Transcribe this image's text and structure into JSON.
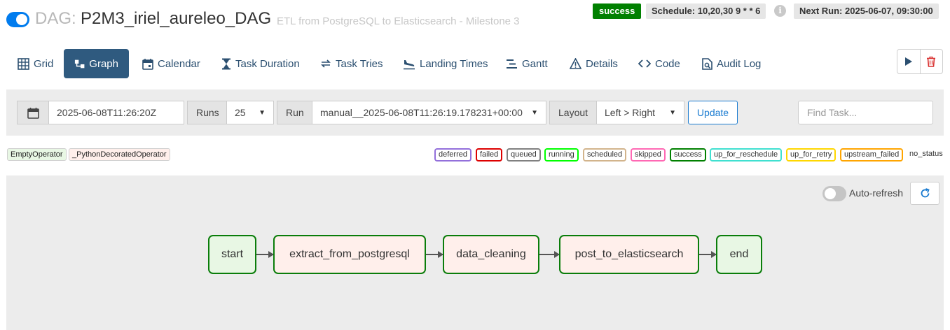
{
  "header": {
    "dag_prefix": "DAG:",
    "dag_id": "P2M3_iriel_aureleo_DAG",
    "description": "ETL from PostgreSQL to Elasticsearch - Milestone 3",
    "state": "success",
    "schedule": "Schedule: 10,20,30 9 * * 6",
    "info_icon_glyph": "i",
    "next_run": "Next Run: 2025-06-07, 09:30:00",
    "colors": {
      "toggle_on": "#017cee",
      "success": "#008000"
    }
  },
  "nav": {
    "tabs": [
      {
        "label": "Grid",
        "icon": "grid-icon"
      },
      {
        "label": "Graph",
        "icon": "graph-icon",
        "active": true
      },
      {
        "label": "Calendar",
        "icon": "calendar-icon"
      },
      {
        "label": "Task Duration",
        "icon": "hourglass-icon"
      },
      {
        "label": "Task Tries",
        "icon": "retry-arrows-icon"
      },
      {
        "label": "Landing Times",
        "icon": "plane-landing-icon"
      },
      {
        "label": "Gantt",
        "icon": "gantt-icon"
      },
      {
        "label": "Details",
        "icon": "warning-triangle-icon"
      },
      {
        "label": "Code",
        "icon": "code-icon"
      },
      {
        "label": "Audit Log",
        "icon": "file-search-icon"
      }
    ],
    "actions": [
      {
        "name": "trigger-dag",
        "icon": "play-icon"
      },
      {
        "name": "delete-dag",
        "icon": "trash-icon"
      }
    ]
  },
  "controls": {
    "base_date": "2025-06-08T11:26:20Z",
    "runs_label": "Runs",
    "runs_value": "25",
    "run_label": "Run",
    "run_value": "manual__2025-06-08T11:26:19.178231+00:00",
    "layout_label": "Layout",
    "layout_value": "Left > Right",
    "update_label": "Update",
    "find_task_placeholder": "Find Task..."
  },
  "operator_legend": [
    {
      "label": "EmptyOperator",
      "color": "#e8f7e4"
    },
    {
      "label": "_PythonDecoratedOperator",
      "color": "#ffefeb"
    }
  ],
  "state_legend": [
    {
      "label": "deferred",
      "color": "#9370db"
    },
    {
      "label": "failed",
      "color": "#dd0000"
    },
    {
      "label": "queued",
      "color": "#808080"
    },
    {
      "label": "running",
      "color": "#00ff00"
    },
    {
      "label": "scheduled",
      "color": "#d2b48c"
    },
    {
      "label": "skipped",
      "color": "#ff69b4"
    },
    {
      "label": "success",
      "color": "#008000"
    },
    {
      "label": "up_for_reschedule",
      "color": "#40e0d0"
    },
    {
      "label": "up_for_retry",
      "color": "#ffd700"
    },
    {
      "label": "upstream_failed",
      "color": "#ffa500"
    }
  ],
  "no_status_label": "no_status",
  "graph": {
    "auto_refresh_label": "Auto-refresh",
    "refresh_icon": "refresh-icon",
    "nodes": [
      {
        "label": "start",
        "color": "#e8f7e4"
      },
      {
        "label": "extract_from_postgresql",
        "color": "#ffefeb"
      },
      {
        "label": "data_cleaning",
        "color": "#ffefeb"
      },
      {
        "label": "post_to_elasticsearch",
        "color": "#ffefeb"
      },
      {
        "label": "end",
        "color": "#e8f7e4"
      }
    ]
  }
}
